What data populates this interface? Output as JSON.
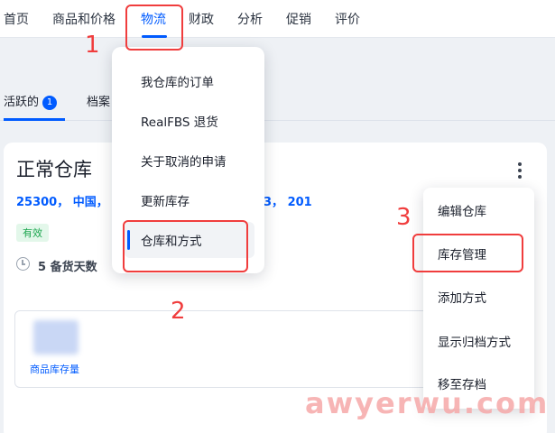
{
  "topnav": {
    "items": [
      "首页",
      "商品和价格",
      "物流",
      "财政",
      "分析",
      "促销",
      "评价"
    ],
    "active": "物流"
  },
  "tabs": {
    "active_label": "活跃的",
    "active_count": "1",
    "second_label": "档案"
  },
  "warehouse": {
    "title": "正常仓库",
    "address_part1": "25300， 中国，",
    "address_part2": "3， 201",
    "status": "有效",
    "days_text": "5 备货天数",
    "inventory_label": "商品库存量"
  },
  "logistics_menu": {
    "items": [
      "我仓库的订单",
      "RealFBS 退货",
      "关于取消的申请",
      "更新库存",
      "仓库和方式"
    ],
    "selected": "仓库和方式"
  },
  "warehouse_menu": {
    "items": [
      "编辑仓库",
      "库存管理",
      "添加方式",
      "显示归档方式",
      "移至存档"
    ]
  },
  "annotations": {
    "step1": "1",
    "step2": "2",
    "step3": "3"
  },
  "watermark": "awyerwu.com",
  "colors": {
    "accent": "#005bff",
    "annotation": "#f03d3d",
    "status_green": "#1aa54d"
  }
}
